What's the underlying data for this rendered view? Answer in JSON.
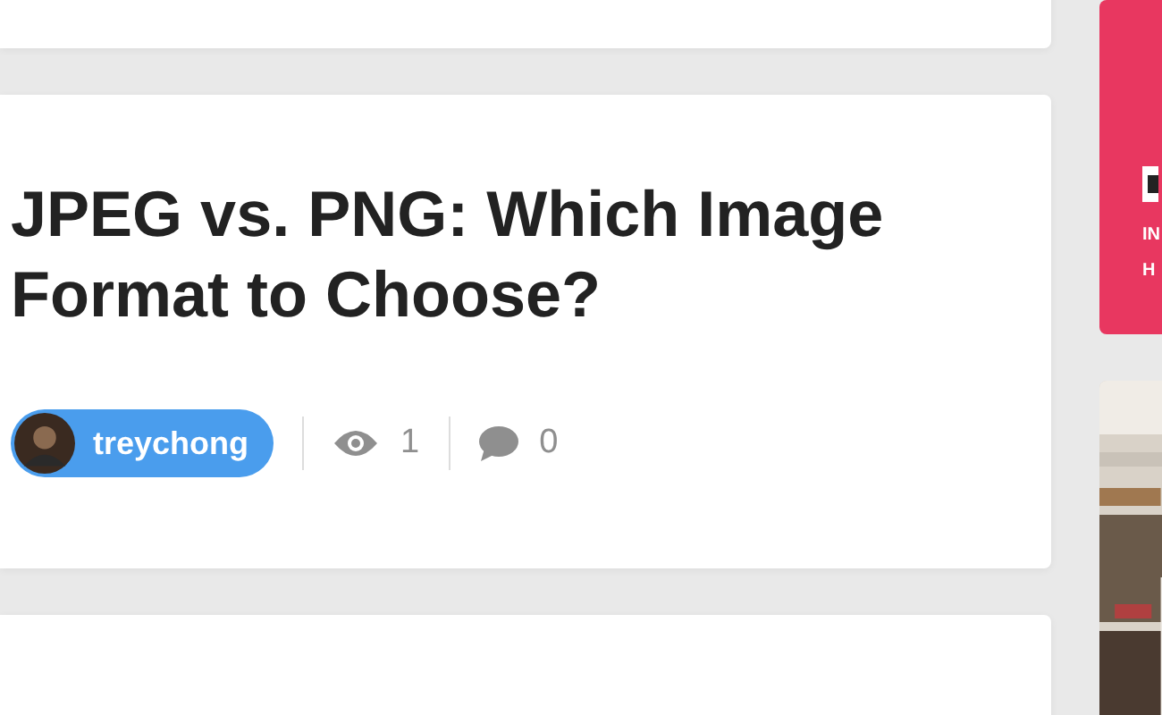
{
  "article": {
    "title": "JPEG vs. PNG: Which Image Format to Choose?",
    "author": "treychong",
    "views": "1",
    "comments": "0"
  },
  "promo": {
    "lines": [
      "IN",
      "H"
    ]
  }
}
